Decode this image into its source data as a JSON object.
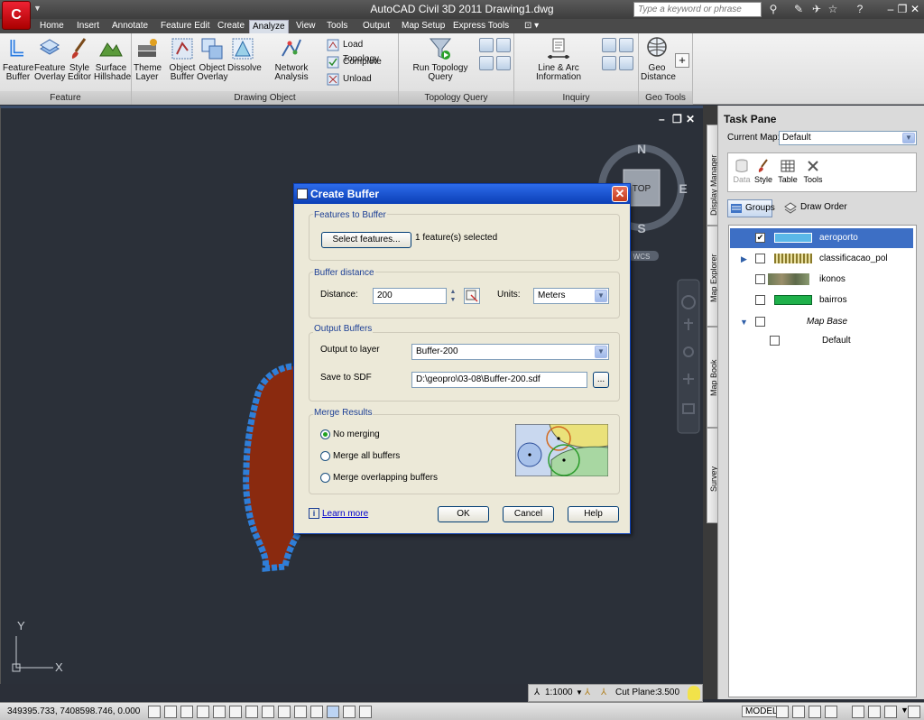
{
  "window": {
    "title": "AutoCAD Civil 3D 2011    Drawing1.dwg",
    "search_placeholder": "Type a keyword or phrase",
    "minimize": "–",
    "restore": "❐",
    "close": "✕"
  },
  "menu_tabs": [
    "Home",
    "Insert",
    "Annotate",
    "Feature Edit",
    "Create",
    "Analyze",
    "View",
    "Tools",
    "Output",
    "Map Setup",
    "Express Tools"
  ],
  "active_tab": "Analyze",
  "ribbon": {
    "feature_panel": {
      "label": "Feature",
      "buttons": [
        "Feature\nBuffer",
        "Feature\nOverlay",
        "Style\nEditor",
        "Surface\nHillshade"
      ]
    },
    "drawing_object_panel": {
      "label": "Drawing Object",
      "buttons": [
        "Theme\nLayer",
        "Object\nBuffer",
        "Object\nOverlay",
        "Dissolve",
        "Network Analysis"
      ],
      "small_buttons": [
        "Load Topology",
        "Complete",
        "Unload"
      ]
    },
    "topology_query_panel": {
      "label": "Topology Query",
      "button": "Run Topology Query"
    },
    "inquiry_panel": {
      "label": "Inquiry",
      "button": "Line & Arc Information"
    },
    "geo_tools_panel": {
      "label": "Geo Tools",
      "button": "Geo\nDistance"
    }
  },
  "viewcube": {
    "north": "N",
    "south": "S",
    "east": "E",
    "top": "TOP",
    "wcs": "WCS"
  },
  "ucs": {
    "x": "X",
    "y": "Y"
  },
  "dialog": {
    "title": "Create Buffer",
    "features_group": "Features to Buffer",
    "select_features_button": "Select features...",
    "selection_status": "1 feature(s) selected",
    "distance_group": "Buffer distance",
    "distance_label": "Distance:",
    "distance_value": "200",
    "units_label": "Units:",
    "units_value": "Meters",
    "output_group": "Output Buffers",
    "output_layer_label": "Output to layer",
    "output_layer_value": "Buffer-200",
    "save_sdf_label": "Save to SDF",
    "save_sdf_value": "D:\\geopro\\03-08\\Buffer-200.sdf",
    "browse_button": "...",
    "merge_group": "Merge Results",
    "merge_options": [
      "No merging",
      "Merge all buffers",
      "Merge overlapping buffers"
    ],
    "merge_selected": "No merging",
    "learn_more": "Learn more",
    "ok": "OK",
    "cancel": "Cancel",
    "help": "Help"
  },
  "task_pane": {
    "title": "Task Pane",
    "current_map_label": "Current Map:",
    "current_map_value": "Default",
    "toolbar": [
      "Data",
      "Style",
      "Table",
      "Tools"
    ],
    "groups_button": "Groups",
    "draw_order_button": "Draw Order",
    "side_tabs": [
      "Display Manager",
      "Map Explorer",
      "Map Book",
      "Survey"
    ],
    "layers": [
      {
        "name": "aeroporto",
        "checked": true,
        "selected": true,
        "swatch": "#5ab8e8"
      },
      {
        "name": "classificacao_pol",
        "checked": false,
        "selected": false,
        "swatch": "pattern"
      },
      {
        "name": "ikonos",
        "checked": false,
        "selected": false,
        "swatch": "image"
      },
      {
        "name": "bairros",
        "checked": false,
        "selected": false,
        "swatch": "#1fb04a"
      }
    ],
    "map_base_group": "Map Base",
    "map_base_child": "Default"
  },
  "drawing_status": {
    "scale": "1:1000",
    "cut_plane_label": "Cut Plane:",
    "cut_plane_value": "3.500"
  },
  "status_bar": {
    "coordinates": "349395.733, 7408598.746, 0.000",
    "model_label": "MODEL"
  },
  "colors": {
    "buffer_outline": "#2f7ed8",
    "feature_fill": "#8a2a0f",
    "canvas_bg": "#2b3039",
    "dialog_title": "#0b3fb6"
  }
}
